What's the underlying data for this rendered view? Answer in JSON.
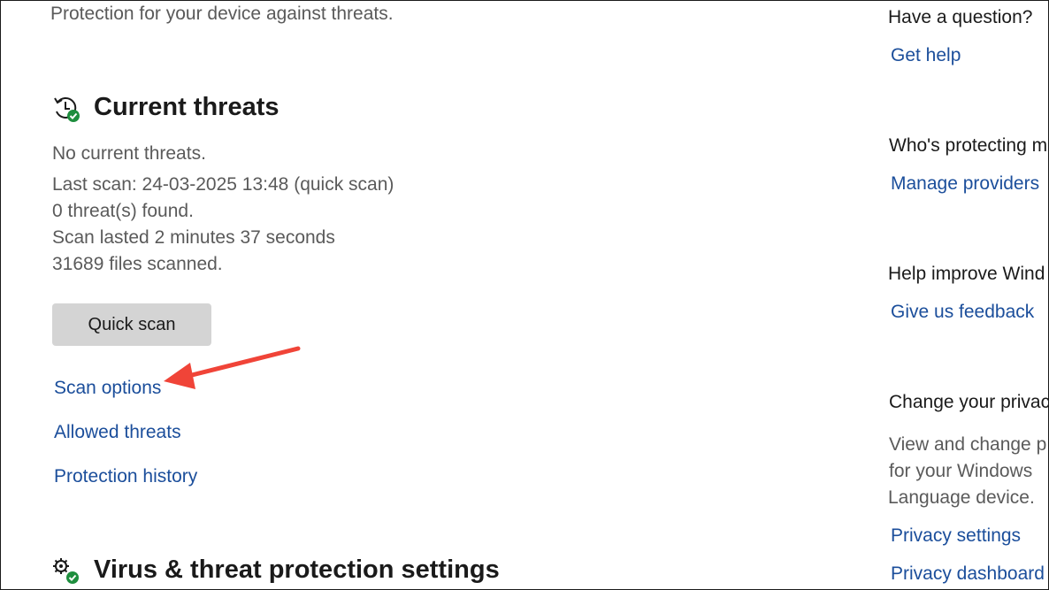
{
  "main": {
    "subtitle": "Protection for your device against threats.",
    "current_threats": {
      "title": "Current threats",
      "icon": "history-check-icon",
      "status": "No current threats.",
      "last_scan": "Last scan: 24-03-2025 13:48 (quick scan)",
      "threats_found": "0 threat(s) found.",
      "scan_duration": "Scan lasted 2 minutes 37 seconds",
      "files_scanned": "31689 files scanned.",
      "quick_scan_label": "Quick scan",
      "links": {
        "scan_options": "Scan options",
        "allowed_threats": "Allowed threats",
        "protection_history": "Protection history"
      }
    },
    "settings_section": {
      "title": "Virus & threat protection settings",
      "icon": "settings-check-icon"
    }
  },
  "sidebar": {
    "question_heading": "Have a question?",
    "get_help": "Get help",
    "protecting_heading": "Who's protecting m",
    "manage_providers": "Manage providers",
    "improve_heading": "Help improve Wind",
    "give_feedback": "Give us feedback",
    "privacy_heading": "Change your privac",
    "privacy_desc_1": "View and change p",
    "privacy_desc_2": "for your Windows",
    "privacy_desc_3": "Language device.",
    "privacy_settings": "Privacy settings",
    "privacy_dashboard": "Privacy dashboard"
  },
  "annotation": {
    "arrow_color": "#f04438",
    "arrow_target": "Scan options"
  },
  "colors": {
    "link": "#1b4e9b",
    "button_bg": "#d4d4d4",
    "check_green": "#1e8e3e"
  }
}
